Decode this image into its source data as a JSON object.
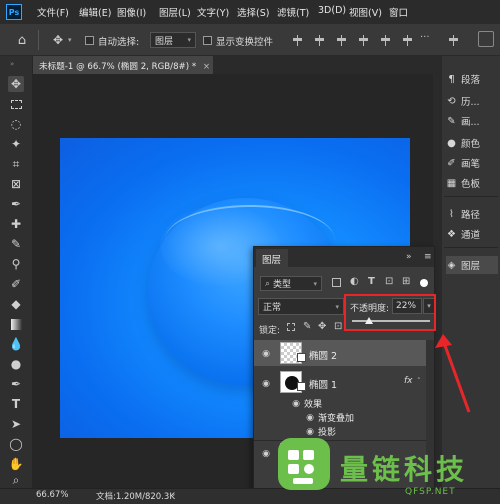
{
  "app": {
    "logo": "Ps"
  },
  "menu": [
    "文件(F)",
    "编辑(E)",
    "图像(I)",
    "图层(L)",
    "文字(Y)",
    "选择(S)",
    "滤镜(T)",
    "3D(D)",
    "视图(V)",
    "窗口"
  ],
  "options": {
    "auto_select_label": "自动选择:",
    "auto_select_value": "图层",
    "show_transform_label": "显示变换控件"
  },
  "document": {
    "tab_title": "未标题-1 @ 66.7% (椭圆 2, RGB/8#) *",
    "tab_close": "×"
  },
  "status": {
    "zoom": "66.67%",
    "doc_info": "文档:1.20M/820.3K"
  },
  "right_panel": {
    "items": [
      {
        "icon": "paragraph-icon",
        "glyph": "¶",
        "label": "段落"
      },
      {
        "icon": "history-icon",
        "glyph": "⟲",
        "label": "历..."
      },
      {
        "icon": "brush-icon",
        "glyph": "✎",
        "label": "画..."
      },
      {
        "icon": "color-icon",
        "glyph": "●",
        "label": "颜色"
      },
      {
        "icon": "brushes-icon",
        "glyph": "✐",
        "label": "画笔"
      },
      {
        "icon": "swatches-icon",
        "glyph": "▦",
        "label": "色板"
      },
      {
        "icon": "paths-icon",
        "glyph": "⌇",
        "label": "路径"
      },
      {
        "icon": "channels-icon",
        "glyph": "❖",
        "label": "通道"
      },
      {
        "icon": "layers-icon",
        "glyph": "◈",
        "label": "图层"
      }
    ]
  },
  "layers_panel": {
    "title": "图层",
    "collapse": "»",
    "menu": "≡",
    "filter_kind": "类型",
    "blend_mode": "正常",
    "opacity_label": "不透明度:",
    "opacity_value": "22%",
    "opacity": 0.22,
    "lock_label": "锁定:",
    "layers": [
      {
        "name": "椭圆 2",
        "selected": true,
        "fx": ""
      },
      {
        "name": "椭圆 1",
        "selected": false,
        "fx": "fx"
      }
    ],
    "effects_label": "效果",
    "effects": [
      "渐变叠加",
      "投影"
    ]
  },
  "watermark": {
    "title": "量链科技",
    "url": "QFSP.NET"
  },
  "colors": {
    "accent_red": "#e8262a",
    "canvas_blue": "#138cff",
    "watermark_green": "#6dbf4b"
  }
}
